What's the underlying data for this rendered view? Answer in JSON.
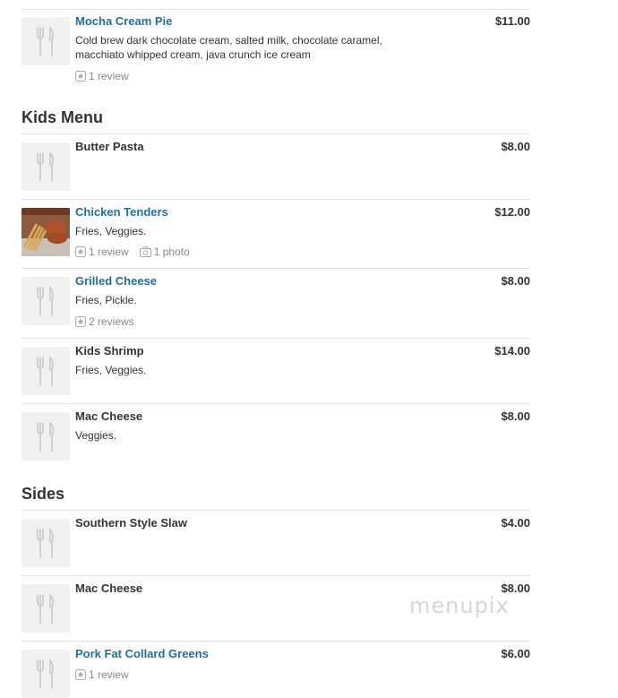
{
  "sections": [
    {
      "title": ""
    },
    {
      "title": "Kids Menu"
    },
    {
      "title": "Sides"
    }
  ],
  "items": {
    "mocha_cream_pie": {
      "name": "Mocha Cream Pie",
      "price": "$11.00",
      "description": "Cold brew dark chocolate cream, salted milk, chocolate caramel, macchiato whipped cream, java crunch ice cream",
      "reviews": "1 review"
    },
    "butter_pasta": {
      "name": "Butter Pasta",
      "price": "$8.00"
    },
    "chicken_tenders": {
      "name": "Chicken Tenders",
      "price": "$12.00",
      "description": "Fries, Veggies.",
      "reviews": "1 review",
      "photos": "1 photo"
    },
    "grilled_cheese": {
      "name": "Grilled Cheese",
      "price": "$8.00",
      "description": "Fries, Pickle.",
      "reviews": "2 reviews"
    },
    "kids_shrimp": {
      "name": "Kids Shrimp",
      "price": "$14.00",
      "description": "Fries, Veggies."
    },
    "mac_cheese_kids": {
      "name": "Mac Cheese",
      "price": "$8.00",
      "description": "Veggies."
    },
    "southern_style_slaw": {
      "name": "Southern Style Slaw",
      "price": "$4.00"
    },
    "mac_cheese_sides": {
      "name": "Mac Cheese",
      "price": "$8.00"
    },
    "pork_fat_collard_greens": {
      "name": "Pork Fat Collard Greens",
      "price": "$6.00",
      "reviews": "1 review"
    }
  },
  "watermark": "menupix",
  "icons": {
    "placeholder": "fork-knife-icon",
    "review": "star-icon",
    "photo": "camera-icon"
  },
  "colors": {
    "link": "#1f6f9f",
    "text": "#333333",
    "meta": "#888888",
    "placeholder_bg": "#f1f1f1",
    "divider": "#e6e6e6"
  }
}
